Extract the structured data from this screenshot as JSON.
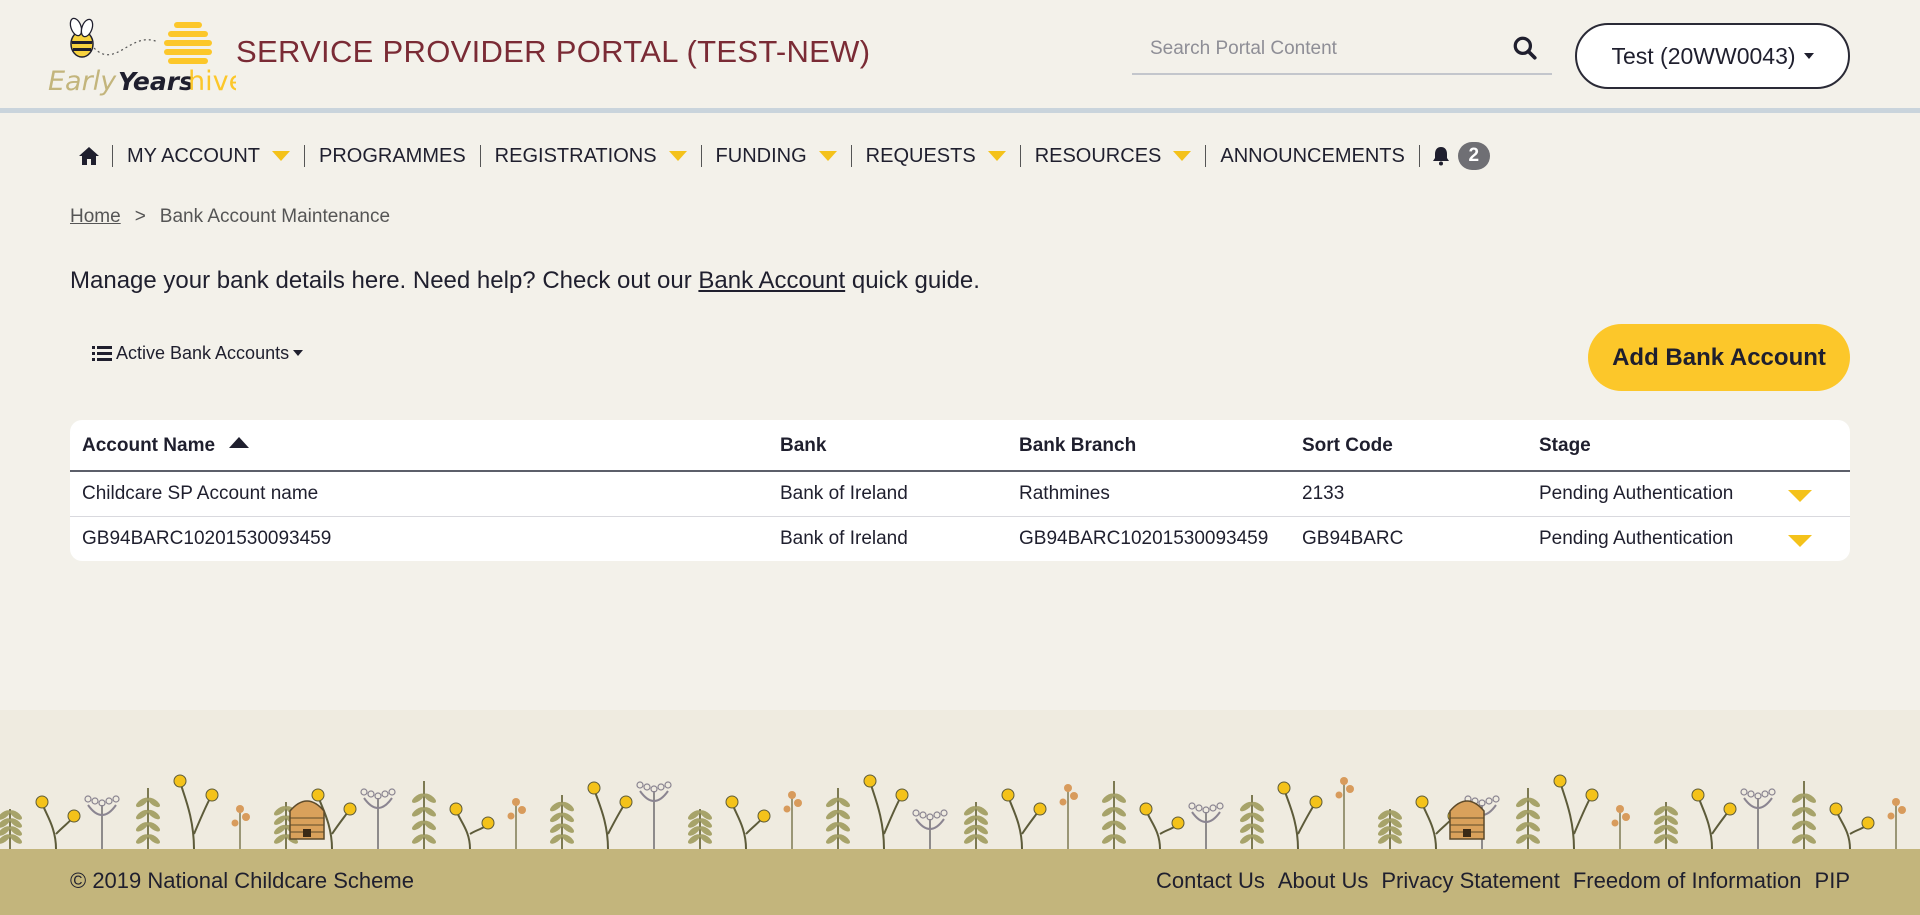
{
  "header": {
    "logo_text_early": "Early",
    "logo_text_years": "Years",
    "logo_text_hive": "hive",
    "portal_title": "SERVICE PROVIDER PORTAL (TEST-NEW)",
    "search_placeholder": "Search Portal Content",
    "account_label": "Test (20WW0043)"
  },
  "nav": {
    "items": [
      {
        "label": "MY ACCOUNT"
      },
      {
        "label": "PROGRAMMES"
      },
      {
        "label": "REGISTRATIONS"
      },
      {
        "label": "FUNDING"
      },
      {
        "label": "REQUESTS"
      },
      {
        "label": "RESOURCES"
      },
      {
        "label": "ANNOUNCEMENTS"
      }
    ],
    "notification_count": "2"
  },
  "breadcrumb": {
    "home": "Home",
    "separator": ">",
    "current": "Bank Account Maintenance"
  },
  "intro": {
    "before": "Manage your bank details here. Need help? Check out our ",
    "link": "Bank Account",
    "after": " quick guide."
  },
  "filter": {
    "label": "Active Bank Accounts"
  },
  "add_button": {
    "label": "Add Bank Account"
  },
  "table": {
    "columns": [
      "Account Name",
      "Bank",
      "Bank Branch",
      "Sort Code",
      "Stage"
    ],
    "rows": [
      [
        "Childcare SP Account name",
        "Bank of Ireland",
        "Rathmines",
        "2133",
        "Pending Authentication"
      ],
      [
        "GB94BARC10201530093459",
        "Bank of Ireland",
        "GB94BARC10201530093459",
        "GB94BARC",
        "Pending Authentication"
      ]
    ]
  },
  "footer": {
    "copyright": "© 2019 National Childcare Scheme",
    "links": [
      "Contact Us",
      "About Us",
      "Privacy Statement",
      "Freedom of Information",
      "PIP"
    ]
  },
  "colors": {
    "accent_yellow": "#fcc72a",
    "title_maroon": "#7a2b35",
    "footer_gold": "#c3b57c",
    "page_bg": "#f3f1ea"
  }
}
